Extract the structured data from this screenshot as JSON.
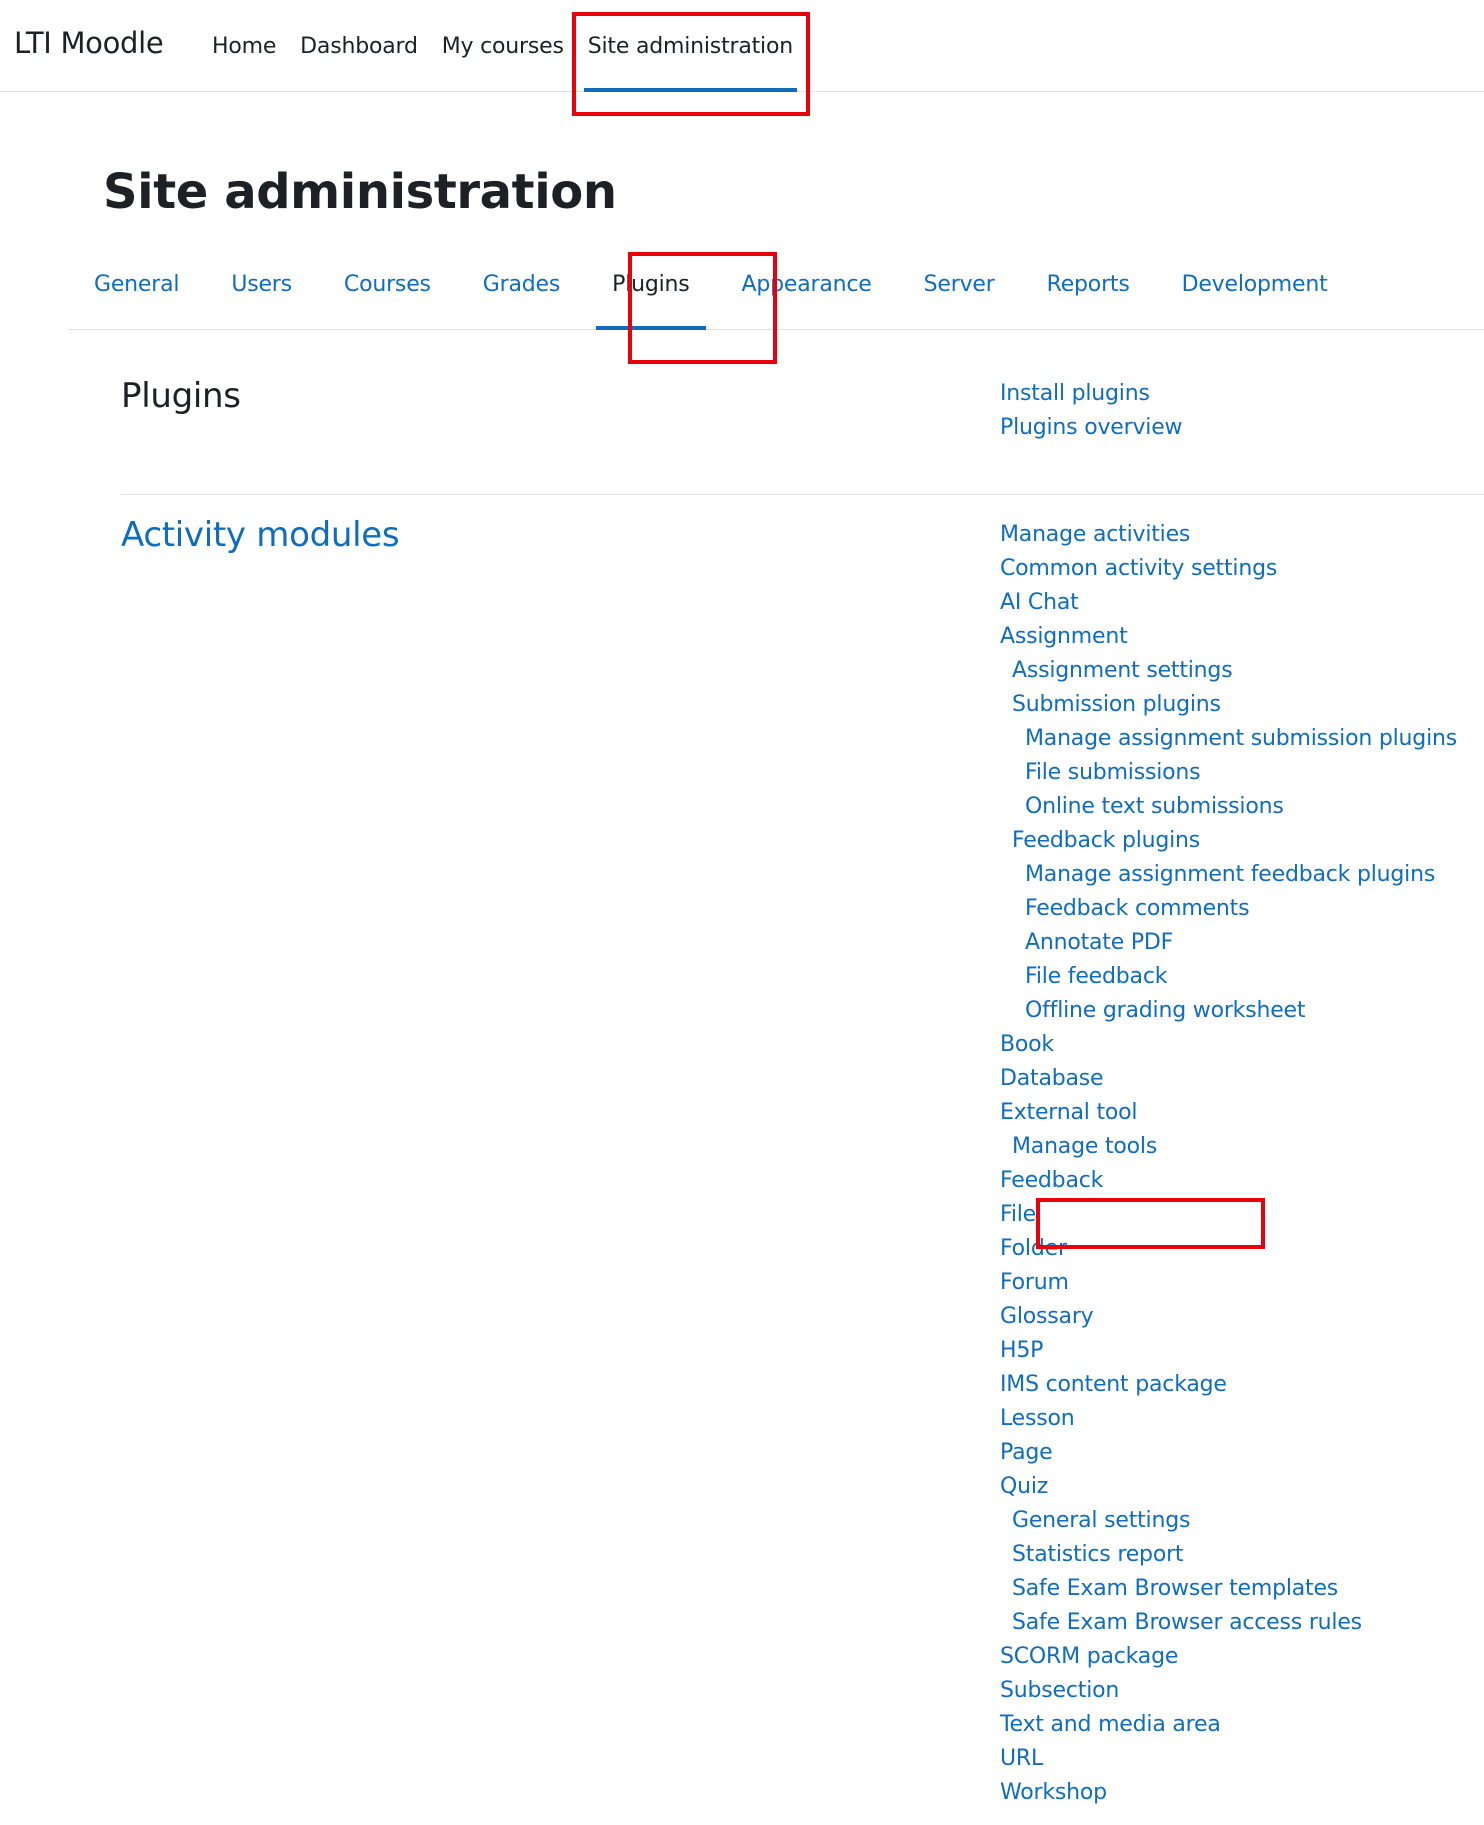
{
  "brand": "LTI Moodle",
  "top_nav": [
    {
      "label": "Home",
      "active": false
    },
    {
      "label": "Dashboard",
      "active": false
    },
    {
      "label": "My courses",
      "active": false
    },
    {
      "label": "Site administration",
      "active": true
    }
  ],
  "page_title": "Site administration",
  "tabs": [
    {
      "label": "General",
      "active": false
    },
    {
      "label": "Users",
      "active": false
    },
    {
      "label": "Courses",
      "active": false
    },
    {
      "label": "Grades",
      "active": false
    },
    {
      "label": "Plugins",
      "active": true
    },
    {
      "label": "Appearance",
      "active": false
    },
    {
      "label": "Server",
      "active": false
    },
    {
      "label": "Reports",
      "active": false
    },
    {
      "label": "Development",
      "active": false
    }
  ],
  "plugins_section": {
    "heading": "Plugins",
    "links": [
      "Install plugins",
      "Plugins overview"
    ]
  },
  "activity_modules": {
    "heading": "Activity modules",
    "links": [
      {
        "label": "Manage activities",
        "level": 0
      },
      {
        "label": "Common activity settings",
        "level": 0
      },
      {
        "label": "AI Chat",
        "level": 0
      },
      {
        "label": "Assignment",
        "level": 0
      },
      {
        "label": "Assignment settings",
        "level": 1
      },
      {
        "label": "Submission plugins",
        "level": 1
      },
      {
        "label": "Manage assignment submission plugins",
        "level": 2
      },
      {
        "label": "File submissions",
        "level": 2
      },
      {
        "label": "Online text submissions",
        "level": 2
      },
      {
        "label": "Feedback plugins",
        "level": 1
      },
      {
        "label": "Manage assignment feedback plugins",
        "level": 2
      },
      {
        "label": "Feedback comments",
        "level": 2
      },
      {
        "label": "Annotate PDF",
        "level": 2
      },
      {
        "label": "File feedback",
        "level": 2
      },
      {
        "label": "Offline grading worksheet",
        "level": 2
      },
      {
        "label": "Book",
        "level": 0
      },
      {
        "label": "Database",
        "level": 0
      },
      {
        "label": "External tool",
        "level": 0
      },
      {
        "label": "Manage tools",
        "level": 1
      },
      {
        "label": "Feedback",
        "level": 0
      },
      {
        "label": "File",
        "level": 0
      },
      {
        "label": "Folder",
        "level": 0
      },
      {
        "label": "Forum",
        "level": 0
      },
      {
        "label": "Glossary",
        "level": 0
      },
      {
        "label": "H5P",
        "level": 0
      },
      {
        "label": "IMS content package",
        "level": 0
      },
      {
        "label": "Lesson",
        "level": 0
      },
      {
        "label": "Page",
        "level": 0
      },
      {
        "label": "Quiz",
        "level": 0
      },
      {
        "label": "General settings",
        "level": 1
      },
      {
        "label": "Statistics report",
        "level": 1
      },
      {
        "label": "Safe Exam Browser templates",
        "level": 1
      },
      {
        "label": "Safe Exam Browser access rules",
        "level": 1
      },
      {
        "label": "SCORM package",
        "level": 0
      },
      {
        "label": "Subsection",
        "level": 0
      },
      {
        "label": "Text and media area",
        "level": 0
      },
      {
        "label": "URL",
        "level": 0
      },
      {
        "label": "Workshop",
        "level": 0
      }
    ]
  },
  "colors": {
    "link": "#0f6cbf",
    "text": "#1d2125",
    "active_underline": "#0f6cbf",
    "highlight_box": "#e8000b",
    "divider": "#dee2e6"
  }
}
